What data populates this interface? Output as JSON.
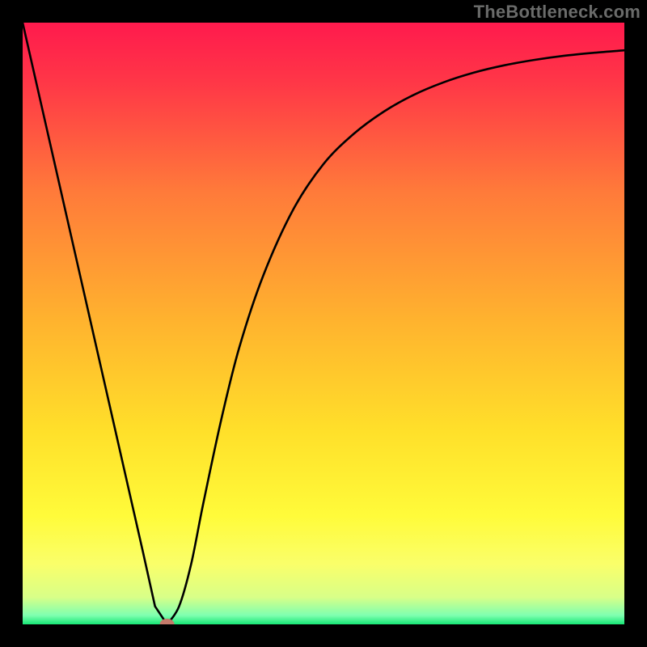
{
  "watermark": "TheBottleneck.com",
  "chart_data": {
    "type": "line",
    "title": "",
    "xlabel": "",
    "ylabel": "",
    "xlim": [
      0,
      100
    ],
    "ylim": [
      0,
      100
    ],
    "gradient_stops": [
      {
        "offset": 0.0,
        "color": "#ff1a4d"
      },
      {
        "offset": 0.1,
        "color": "#ff3747"
      },
      {
        "offset": 0.28,
        "color": "#ff7a3a"
      },
      {
        "offset": 0.5,
        "color": "#ffb42e"
      },
      {
        "offset": 0.68,
        "color": "#ffe02a"
      },
      {
        "offset": 0.82,
        "color": "#fffb3a"
      },
      {
        "offset": 0.9,
        "color": "#faff6a"
      },
      {
        "offset": 0.955,
        "color": "#d8ff88"
      },
      {
        "offset": 0.985,
        "color": "#7fffb0"
      },
      {
        "offset": 1.0,
        "color": "#17e776"
      }
    ],
    "series": [
      {
        "name": "curve",
        "x": [
          0,
          5,
          10,
          15,
          20,
          22,
          24,
          26,
          28,
          30,
          33,
          36,
          40,
          45,
          50,
          55,
          60,
          65,
          70,
          75,
          80,
          85,
          90,
          95,
          100
        ],
        "y": [
          100,
          78,
          56,
          34,
          12,
          3,
          0,
          3,
          10,
          20,
          34,
          46,
          58,
          69,
          76.5,
          81.5,
          85.2,
          88.0,
          90.1,
          91.7,
          92.9,
          93.8,
          94.5,
          95.0,
          95.4
        ]
      }
    ],
    "marker": {
      "x": 24,
      "y": 0,
      "color": "#c47a6a",
      "rx": 9,
      "ry": 7
    }
  }
}
